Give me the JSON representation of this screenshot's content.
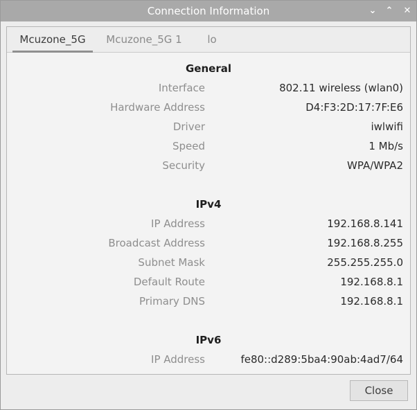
{
  "window": {
    "title": "Connection Information",
    "controls": {
      "minimize": "⌄",
      "maximize": "⌃",
      "close": "✕"
    }
  },
  "tabs": [
    {
      "label": "Mcuzone_5G"
    },
    {
      "label": "Mcuzone_5G 1"
    },
    {
      "label": "lo"
    }
  ],
  "general": {
    "title": "General",
    "rows": [
      {
        "label": "Interface",
        "value": "802.11 wireless (wlan0)"
      },
      {
        "label": "Hardware Address",
        "value": "D4:F3:2D:17:7F:E6"
      },
      {
        "label": "Driver",
        "value": "iwlwifi"
      },
      {
        "label": "Speed",
        "value": "1 Mb/s"
      },
      {
        "label": "Security",
        "value": "WPA/WPA2"
      }
    ]
  },
  "ipv4": {
    "title": "IPv4",
    "rows": [
      {
        "label": "IP Address",
        "value": "192.168.8.141"
      },
      {
        "label": "Broadcast Address",
        "value": "192.168.8.255"
      },
      {
        "label": "Subnet Mask",
        "value": "255.255.255.0"
      },
      {
        "label": "Default Route",
        "value": "192.168.8.1"
      },
      {
        "label": "Primary DNS",
        "value": "192.168.8.1"
      }
    ]
  },
  "ipv6": {
    "title": "IPv6",
    "rows": [
      {
        "label": "IP Address",
        "value": "fe80::d289:5ba4:90ab:4ad7/64"
      }
    ]
  },
  "footer": {
    "close_label": "Close"
  }
}
